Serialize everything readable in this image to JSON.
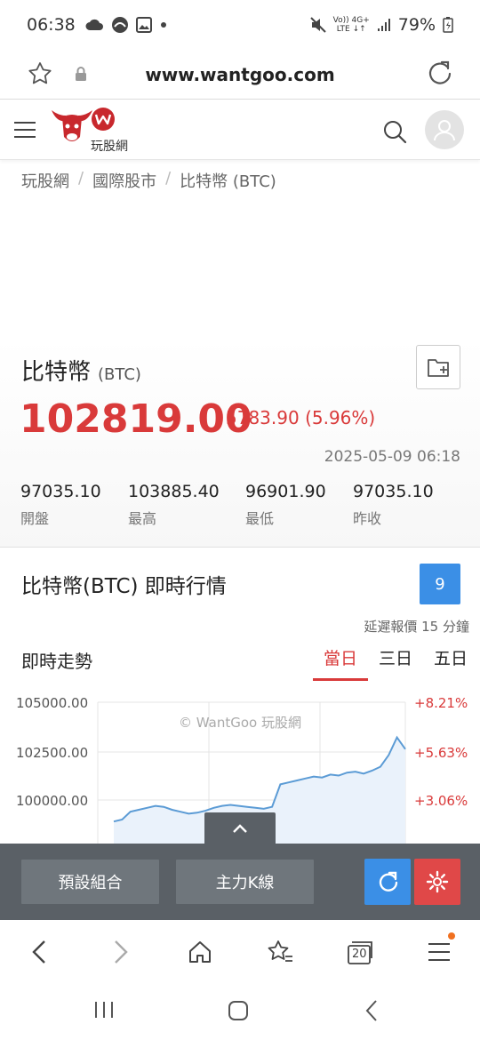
{
  "status_bar": {
    "time": "06:38",
    "network_line1": "Vo)) 4G+",
    "network_line2": "LTE ↓↑",
    "battery": "79%"
  },
  "browser": {
    "url": "www.wantgoo.com"
  },
  "site": {
    "logo_text": "玩股網"
  },
  "breadcrumb": [
    "玩股網",
    "國際股市",
    "比特幣 (BTC)"
  ],
  "quote": {
    "name": "比特幣",
    "code": "(BTC)",
    "price": "102819.00",
    "change": "5783.90 (5.96%)",
    "timestamp": "2025-05-09 06:18",
    "stats": [
      {
        "value": "97035.10",
        "label": "開盤"
      },
      {
        "value": "103885.40",
        "label": "最高"
      },
      {
        "value": "96901.90",
        "label": "最低"
      },
      {
        "value": "97035.10",
        "label": "昨收"
      }
    ]
  },
  "realtime": {
    "title": "比特幣(BTC) 即時行情",
    "badge": "9",
    "delay_note": "延遲報價 15 分鐘",
    "trend_label": "即時走勢",
    "tabs": [
      "當日",
      "三日",
      "五日"
    ],
    "active_tab": 0
  },
  "chart_data": {
    "type": "area",
    "watermark": "© WantGoo 玩股網",
    "y_ticks": [
      "105000.00",
      "102500.00",
      "100000.00"
    ],
    "pct_ticks": [
      "+8.21%",
      "+5.63%",
      "+3.06%"
    ],
    "ylim": [
      97000,
      105000
    ],
    "line_color": "#5b9bd5",
    "values": [
      98900,
      99000,
      99400,
      99500,
      99600,
      99700,
      99650,
      99500,
      99400,
      99300,
      99350,
      99450,
      99600,
      99700,
      99750,
      99700,
      99650,
      99600,
      99550,
      99650,
      100800,
      100900,
      101000,
      101100,
      101200,
      101150,
      101300,
      101250,
      101400,
      101450,
      101350,
      101500,
      101700,
      102300,
      103200,
      102600
    ]
  },
  "toolbar": {
    "btn1": "預設組合",
    "btn2": "主力K線"
  },
  "colors": {
    "up": "#d93a3a",
    "blue": "#3b8fe6",
    "toolbar_bg": "#5a6066",
    "gear_bg": "#e04848"
  },
  "browser_nav": {
    "tabs_count": "20"
  }
}
